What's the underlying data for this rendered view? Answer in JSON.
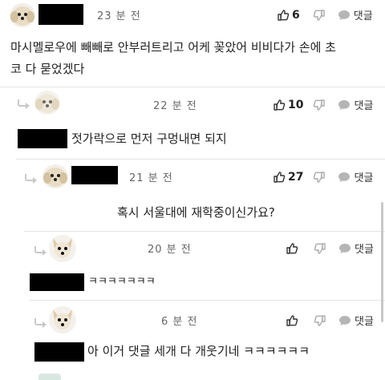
{
  "comments": [
    {
      "time": "23 분 전",
      "likes": "6",
      "reply_label": "댓글",
      "text_line1": "마시멜로우에 빼빼로 안부러트리고 어케 꽂았어 비비다가 손에 초",
      "text_line2": "코 다 묻었겠다"
    },
    {
      "time": "22 분 전",
      "likes": "10",
      "reply_label": "댓글",
      "text": "젓가락으로 먼저 구멍내면 되지"
    },
    {
      "time": "21 분 전",
      "likes": "27",
      "reply_label": "댓글",
      "text": "혹시 서울대에 재학중이신가요?"
    },
    {
      "time": "20 분 전",
      "likes": "",
      "reply_label": "댓글",
      "text": "ㅋㅋㅋㅋㅋㅋㅋ"
    },
    {
      "time": "6 분 전",
      "likes": "",
      "reply_label": "댓글",
      "text": "아 이거 댓글 세개 다 개웃기네 ㅋㅋㅋㅋㅋㅋ"
    }
  ],
  "icons": {
    "like": "thumbs-up-icon",
    "dislike": "thumbs-down-icon",
    "reply": "speech-bubble-icon",
    "reply_arrow": "reply-arrow-icon"
  },
  "colors": {
    "redaction": "#000000",
    "muted": "#999999",
    "text": "#222222"
  }
}
